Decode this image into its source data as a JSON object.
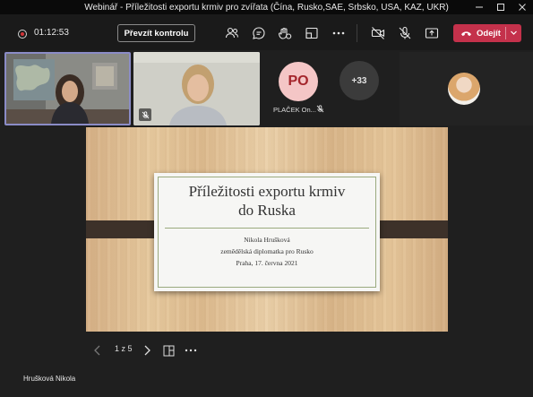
{
  "window": {
    "title": "Webinář - Příležitosti exportu krmiv pro zvířata (Čína, Rusko,SAE, Srbsko, USA, KAZ, UKR)",
    "controls": [
      "minimize-icon",
      "maximize-icon",
      "close-icon"
    ]
  },
  "toolbar": {
    "timer": "01:12:53",
    "take_control_label": "Převzít kontrolu",
    "icons": [
      "participants-icon",
      "chat-icon",
      "reactions-icon",
      "breakout-rooms-icon",
      "more-actions-icon",
      "camera-off-icon",
      "mic-off-icon",
      "share-icon"
    ],
    "leave_label": "Odejít",
    "leave_color": "#c4314b"
  },
  "participants": {
    "tile1_name": "",
    "tile2_name": "",
    "po_initials": "PO",
    "po_name": "PLAČEK On...",
    "more_count": "+33"
  },
  "slide": {
    "title_line1": "Příležitosti exportu krmiv",
    "title_line2": "do Ruska",
    "author": "Nikola Hrušková",
    "role": "zemědělská diplomatka pro Rusko",
    "place_date": "Praha, 17. června 2021",
    "page_indicator": "1 z 5"
  },
  "presenter": {
    "name": "Hrušková Nikola"
  }
}
